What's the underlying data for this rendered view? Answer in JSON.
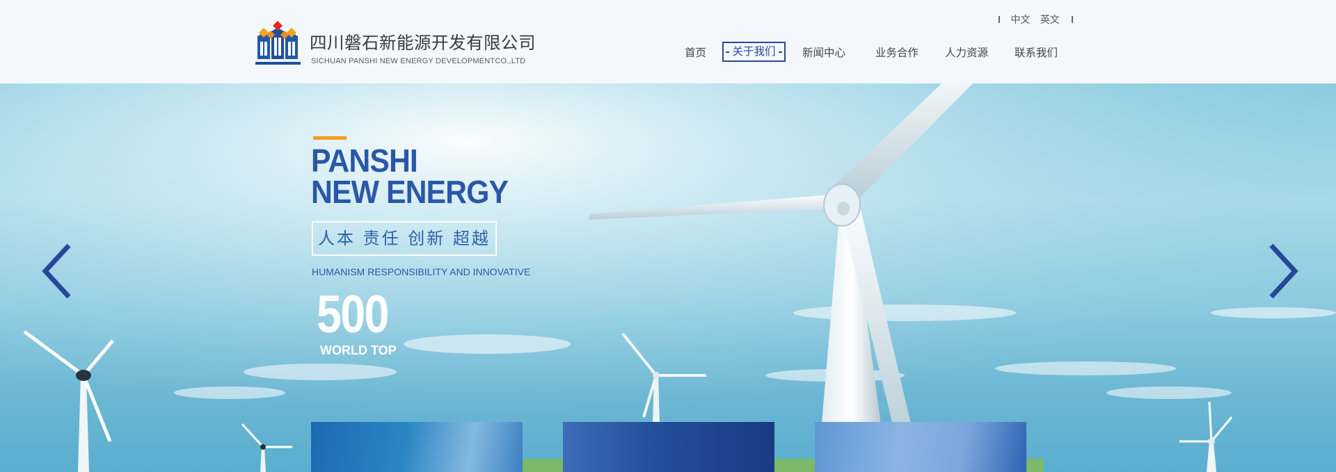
{
  "header": {
    "company_name_cn": "四川磐石新能源开发有限公司",
    "company_name_en": "SICHUAN PANSHI NEW ENERGY DEVELOPMENTCO.,LTD",
    "lang": {
      "zh": "中文",
      "en": "英文"
    }
  },
  "nav": {
    "items": [
      {
        "label": "首页"
      },
      {
        "label": "关于我们",
        "active": true
      },
      {
        "label": "新闻中心"
      },
      {
        "label": "业务合作"
      },
      {
        "label": "人力资源"
      },
      {
        "label": "联系我们"
      }
    ]
  },
  "banner": {
    "title_line1": "PANSHI",
    "title_line2": "NEW ENERGY",
    "values_cn": "人本 责任 创新 超越",
    "values_en": "HUMANISM RESPONSIBILITY AND INNOVATIVE",
    "number": "500",
    "number_sub": "WORLD TOP"
  },
  "colors": {
    "brand_blue": "#2a58a8",
    "accent_orange": "#f39e1b",
    "nav_active": "#27489a",
    "header_bg": "#f4f8fc"
  },
  "icons": {
    "logo": "panshi-logo-icon",
    "prev": "chevron-left-icon",
    "next": "chevron-right-icon"
  }
}
